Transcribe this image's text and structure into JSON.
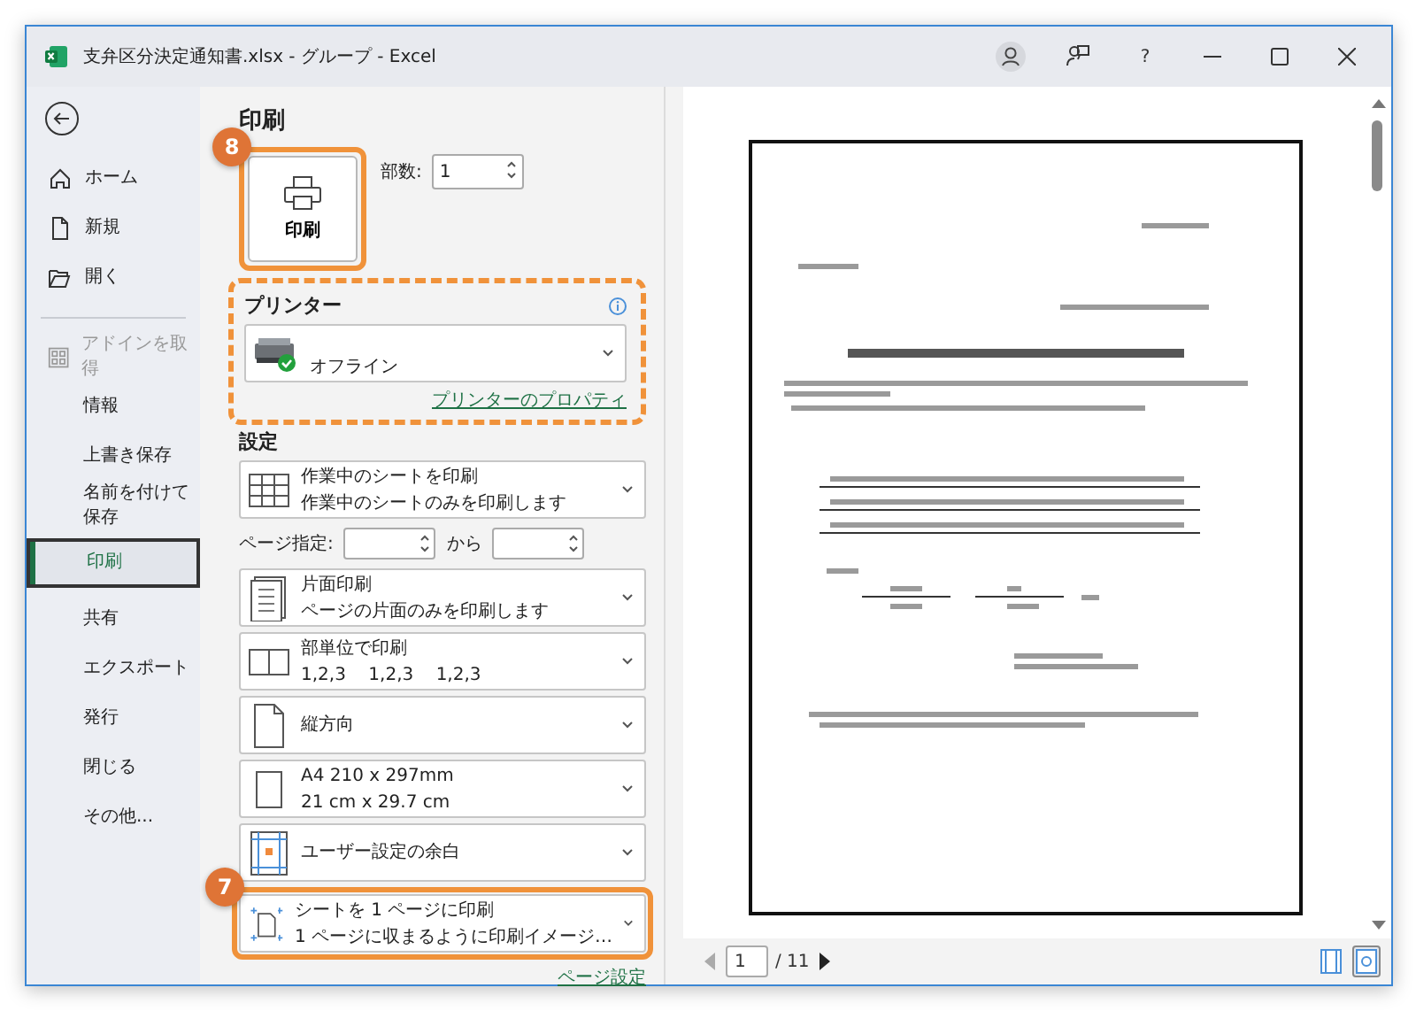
{
  "window": {
    "title": "支弁区分決定通知書.xlsx  -  グループ  -  Excel",
    "help_button": "?"
  },
  "sidebar": {
    "groups": [
      [
        {
          "kind": "home",
          "label": "ホーム",
          "selected": false,
          "disabled": false
        },
        {
          "kind": "new",
          "label": "新規",
          "selected": false,
          "disabled": false
        },
        {
          "kind": "open",
          "label": "開く",
          "selected": false,
          "disabled": false
        }
      ],
      [
        {
          "kind": "addins",
          "label": "アドインを取得",
          "selected": false,
          "disabled": true
        },
        {
          "kind": "command",
          "label": "情報",
          "selected": false,
          "disabled": false
        },
        {
          "kind": "command",
          "label": "上書き保存",
          "selected": false,
          "disabled": false
        },
        {
          "kind": "command",
          "label": "名前を付けて保存",
          "selected": false,
          "disabled": false
        },
        {
          "kind": "command",
          "label": "印刷",
          "selected": true,
          "disabled": false
        },
        {
          "kind": "command",
          "label": "共有",
          "selected": false,
          "disabled": false
        },
        {
          "kind": "command",
          "label": "エクスポート",
          "selected": false,
          "disabled": false
        },
        {
          "kind": "command",
          "label": "発行",
          "selected": false,
          "disabled": false
        },
        {
          "kind": "command",
          "label": "閉じる",
          "selected": false,
          "disabled": false
        },
        {
          "kind": "command",
          "label": "その他...",
          "selected": false,
          "disabled": false
        }
      ]
    ]
  },
  "print": {
    "heading": "印刷",
    "print_button": {
      "label": "印刷",
      "callout": "8"
    },
    "copies_label": "部数:",
    "copies": "1",
    "printer": {
      "heading": "プリンター",
      "status": "オフライン",
      "properties_link": "プリンターのプロパティ",
      "highlighted": true
    },
    "settings_heading": "設定",
    "settings": [
      {
        "kind": "sheet",
        "title": "作業中のシートを印刷",
        "subtitle": "作業中のシートのみを印刷します"
      },
      {
        "kind": "pages",
        "label": "ページ指定:",
        "to_label": "から"
      },
      {
        "kind": "sides",
        "title": "片面印刷",
        "subtitle": "ページの片面のみを印刷します"
      },
      {
        "kind": "collate",
        "title": "部単位で印刷",
        "subtitle": "1,2,3    1,2,3    1,2,3"
      },
      {
        "kind": "orientation",
        "title": "縦方向"
      },
      {
        "kind": "paper",
        "title": "A4 210 x 297mm",
        "subtitle": "21 cm x 29.7 cm"
      },
      {
        "kind": "margins",
        "title": "ユーザー設定の余白"
      },
      {
        "kind": "scaling",
        "title": "シートを 1 ページに印刷",
        "subtitle": "1 ページに収まるように印刷イメージ…",
        "callout": "7"
      }
    ],
    "page_setup_link": "ページ設定"
  },
  "preview": {
    "page": "1",
    "total": "/ 11"
  }
}
